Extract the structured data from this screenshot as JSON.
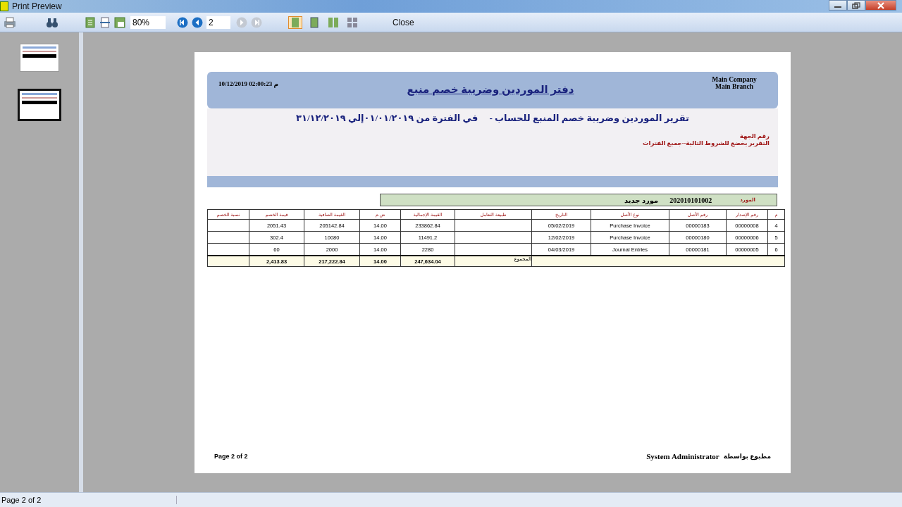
{
  "window": {
    "title": "Print Preview"
  },
  "toolbar": {
    "zoom": "80%",
    "page": "2",
    "close": "Close",
    "nav_buttons": [
      {
        "kind": "first",
        "disabled": false
      },
      {
        "kind": "prev",
        "disabled": false
      },
      {
        "kind": "next",
        "disabled": true
      },
      {
        "kind": "last",
        "disabled": true
      }
    ],
    "view_modes": [
      {
        "kind": "one",
        "selected": true
      },
      {
        "kind": "two",
        "selected": false
      },
      {
        "kind": "wide",
        "selected": false
      },
      {
        "kind": "multi",
        "selected": false
      }
    ]
  },
  "thumbnails": [
    {
      "selected": false
    },
    {
      "selected": true
    }
  ],
  "report": {
    "datetime": "10/12/2019 02:00:23 م",
    "title": "دفتر الموردين وضريبة خصم منبع",
    "company": "Main Company",
    "branch": "Main Branch",
    "subtitle": "تقرير الموردين وضريبة خصم المنبع للحساب -     في الفترة من ٠١/٠١/٢٠١٩إلي ٣١/١٢/٢٠١٩",
    "entity_label": "رقم الجهة",
    "conditions": "التقرير يخضع للشروط التالية--جميع الفترات",
    "supplier_label": "المورد",
    "supplier_code": "202010101002",
    "supplier_name": "مورد جديد",
    "columns": [
      "م",
      "رقم الإصدار",
      "رقم الأصل",
      "نوع الأصل",
      "التاريخ",
      "طبيعة التعامل",
      "القيمة الإجمالية",
      "ض.م",
      "القيمة الصافية",
      "قيمة الخصم",
      "نسبة الخصم"
    ],
    "rows": [
      [
        "4",
        "00000008",
        "00000183",
        "Purchase Invoice",
        "05/02/2019",
        "",
        "233862.84",
        "14.00",
        "205142.84",
        "2051.43",
        ""
      ],
      [
        "5",
        "00000006",
        "00000180",
        "Purchase Invoice",
        "12/02/2019",
        "",
        "11491.2",
        "14.00",
        "10080",
        "302.4",
        ""
      ],
      [
        "6",
        "00000005",
        "00000181",
        "Journal Entries",
        "04/03/2019",
        "",
        "2280",
        "14.00",
        "2000",
        "60",
        ""
      ]
    ],
    "total": {
      "label": "المجموع",
      "gross": "247,634.04",
      "tax": "14.00",
      "net": "217,222.84",
      "discount": "2,413.83"
    },
    "page_number": "Page 2 of 2",
    "printed_by": "System Administrator",
    "printed_by_label": "مطبوع بواسطة"
  },
  "status_bar": {
    "page": "Page 2 of 2"
  }
}
